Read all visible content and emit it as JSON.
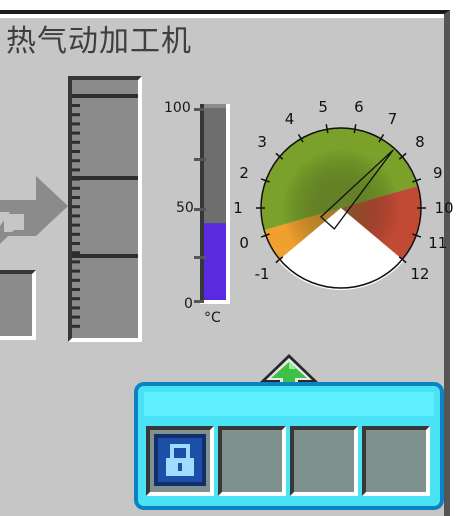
{
  "window": {
    "title": "热气动加工机"
  },
  "thermometer": {
    "unit": "°C",
    "ticks": [
      "100",
      "50",
      "0"
    ],
    "fill_level": 0.4
  },
  "gauge": {
    "labels": [
      "-1",
      "0",
      "1",
      "2",
      "3",
      "4",
      "5",
      "6",
      "7",
      "8",
      "9",
      "10",
      "11",
      "12"
    ],
    "needle_value": 7.6,
    "colors": {
      "green": "#7aa22b",
      "red": "#c24a35",
      "orange": "#f0a02e"
    }
  },
  "upgrade_panel": {
    "slots": [
      {
        "item": "lock-icon"
      },
      {
        "item": ""
      },
      {
        "item": ""
      },
      {
        "item": ""
      }
    ],
    "colors": {
      "panel": "#4ae3f5",
      "border": "#0b83c2",
      "arrow": "#3fbf46"
    }
  }
}
